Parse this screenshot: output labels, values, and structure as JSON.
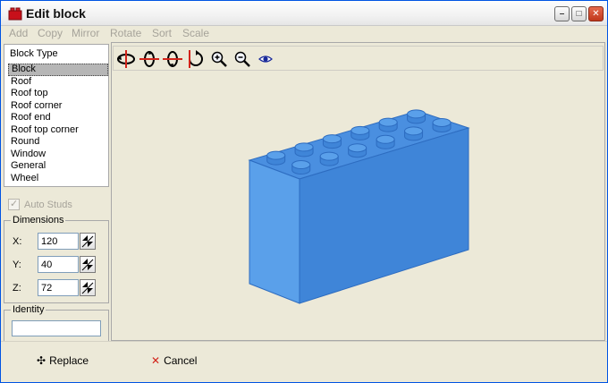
{
  "window": {
    "title": "Edit block"
  },
  "menu": {
    "items": [
      "Add",
      "Copy",
      "Mirror",
      "Rotate",
      "Sort",
      "Scale"
    ]
  },
  "block_type": {
    "label": "Block Type",
    "items": [
      "Block",
      "Roof",
      "Roof top",
      "Roof corner",
      "Roof end",
      "Roof top corner",
      "Round",
      "Window",
      "General",
      "Wheel"
    ],
    "selected": "Block"
  },
  "auto_studs": {
    "label": "Auto Studs",
    "checked": true,
    "enabled": false
  },
  "dimensions": {
    "label": "Dimensions",
    "x": {
      "label": "X:",
      "value": "120"
    },
    "y": {
      "label": "Y:",
      "value": "40"
    },
    "z": {
      "label": "Z:",
      "value": "72"
    }
  },
  "identity": {
    "label": "Identity",
    "value": ""
  },
  "toolbar": {
    "icons": [
      "rotate-horizontal-icon",
      "rotate-vertical-left-icon",
      "rotate-vertical-right-icon",
      "rotate-roll-icon",
      "zoom-in-icon",
      "zoom-out-icon",
      "eye-icon"
    ]
  },
  "buttons": {
    "replace_label": "Replace",
    "cancel_label": "Cancel"
  },
  "colors": {
    "brick_top": "#4a8fe0",
    "brick_front": "#3f85d8",
    "brick_side": "#5aa0ea",
    "accent_red": "#d2231a"
  }
}
